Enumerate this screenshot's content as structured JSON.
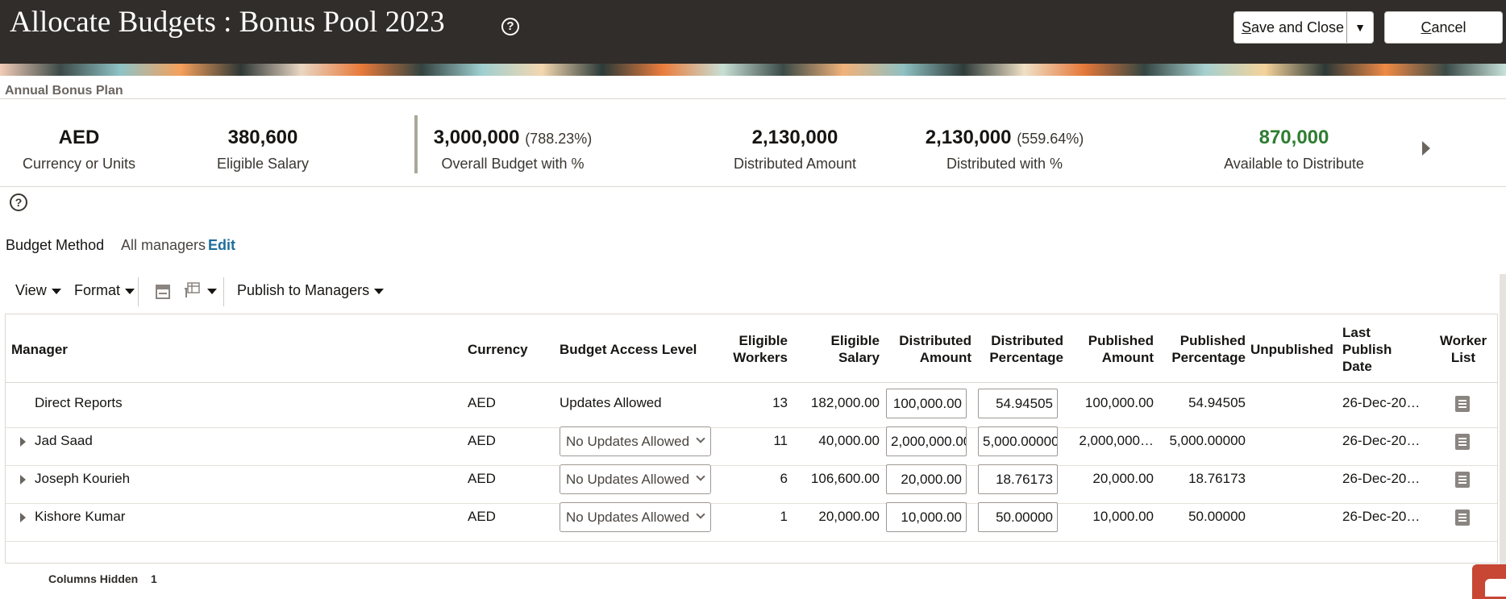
{
  "header": {
    "title": "Allocate Budgets : Bonus Pool 2023",
    "help_icon": "help-icon",
    "save_label": "Save and Close",
    "cancel_label": "Cancel"
  },
  "plan": {
    "name": "Annual Bonus Plan"
  },
  "summary": {
    "currency": {
      "value": "AED",
      "caption": "Currency or Units"
    },
    "eligible_salary": {
      "value": "380,600",
      "caption": "Eligible Salary"
    },
    "overall_budget": {
      "value": "3,000,000",
      "pct": "(788.23%)",
      "caption": "Overall Budget with %"
    },
    "distributed_amount": {
      "value": "2,130,000",
      "caption": "Distributed Amount"
    },
    "distributed_pct": {
      "value": "2,130,000",
      "pct": "(559.64%)",
      "caption": "Distributed with %"
    },
    "available": {
      "value": "870,000",
      "caption": "Available to Distribute",
      "color": "#2e7d32"
    }
  },
  "budget_method": {
    "label": "Budget Method",
    "value": "All managers",
    "edit": "Edit"
  },
  "toolbar": {
    "view": "View",
    "format": "Format",
    "publish": "Publish to Managers"
  },
  "table": {
    "headers": {
      "manager": "Manager",
      "currency": "Currency",
      "access": "Budget Access Level",
      "eligible_workers_1": "Eligible",
      "eligible_workers_2": "Workers",
      "eligible_salary_1": "Eligible",
      "eligible_salary_2": "Salary",
      "dist_amount_1": "Distributed",
      "dist_amount_2": "Amount",
      "dist_pct_1": "Distributed",
      "dist_pct_2": "Percentage",
      "pub_amount_1": "Published",
      "pub_amount_2": "Amount",
      "pub_pct_1": "Published",
      "pub_pct_2": "Percentage",
      "unpublished": "Unpublished",
      "last_publish_1": "Last",
      "last_publish_2": "Publish",
      "last_publish_3": "Date",
      "worker_list_1": "Worker",
      "worker_list_2": "List"
    },
    "rows": [
      {
        "manager": "Direct Reports",
        "currency": "AED",
        "access": "Updates Allowed",
        "workers": "13",
        "salary": "182,000.00",
        "dist_amount": "100,000.00",
        "dist_pct": "54.94505",
        "pub_amount": "100,000.00",
        "pub_pct": "54.94505",
        "unpublished": "",
        "last_date": "26-Dec-20…"
      },
      {
        "manager": "Jad Saad",
        "currency": "AED",
        "access": "No Updates Allowed",
        "workers": "11",
        "salary": "40,000.00",
        "dist_amount": "2,000,000.00",
        "dist_pct": "5,000.00000",
        "pub_amount": "2,000,000…",
        "pub_pct": "5,000.00000",
        "unpublished": "",
        "last_date": "26-Dec-20…"
      },
      {
        "manager": "Joseph Kourieh",
        "currency": "AED",
        "access": "No Updates Allowed",
        "workers": "6",
        "salary": "106,600.00",
        "dist_amount": "20,000.00",
        "dist_pct": "18.76173",
        "pub_amount": "20,000.00",
        "pub_pct": "18.76173",
        "unpublished": "",
        "last_date": "26-Dec-20…"
      },
      {
        "manager": "Kishore Kumar",
        "currency": "AED",
        "access": "No Updates Allowed",
        "workers": "1",
        "salary": "20,000.00",
        "dist_amount": "10,000.00",
        "dist_pct": "50.00000",
        "pub_amount": "10,000.00",
        "pub_pct": "50.00000",
        "unpublished": "",
        "last_date": "26-Dec-20…"
      }
    ]
  },
  "footer": {
    "columns_hidden_label": "Columns Hidden",
    "columns_hidden_value": "1"
  }
}
